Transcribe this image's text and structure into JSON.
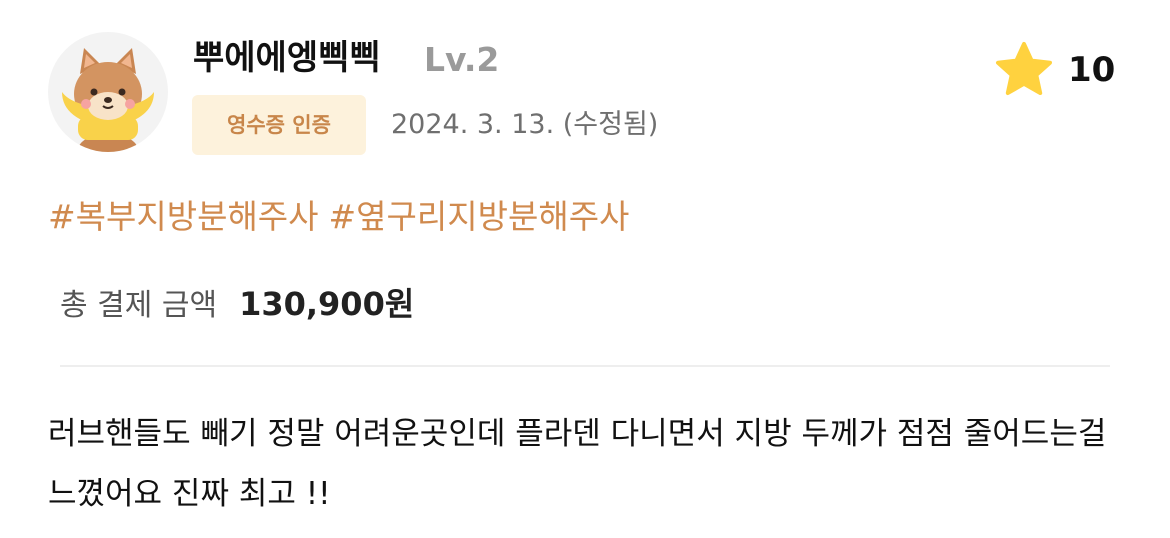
{
  "user": {
    "name": "뿌에에엥삑삑",
    "level": "Lv.2",
    "avatar_icon": "puppy-face-avatar-icon"
  },
  "badge": {
    "label": "영수증 인증",
    "background": "#fdf2dc",
    "color": "#c8864a"
  },
  "date": "2024. 3. 13. (수정됨)",
  "rating": {
    "icon": "star-icon",
    "value": "10",
    "star_color": "#ffd23f"
  },
  "hashtags": [
    "#복부지방분해주사",
    "#옆구리지방분해주사"
  ],
  "hashtag_color": "#d08a4e",
  "payment": {
    "label": "총 결제 금액",
    "amount": "130,900원"
  },
  "review": {
    "text": "러브핸들도 빼기 정말 어려운곳인데 플라덴 다니면서 지방 두께가 점점 줄어드는걸 느꼈어요 진짜 최고 !!"
  }
}
